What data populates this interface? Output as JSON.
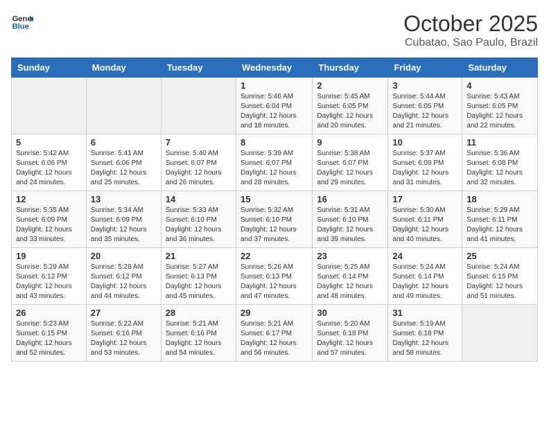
{
  "logo": {
    "line1": "General",
    "line2": "Blue"
  },
  "title": "October 2025",
  "subtitle": "Cubatao, Sao Paulo, Brazil",
  "days_of_week": [
    "Sunday",
    "Monday",
    "Tuesday",
    "Wednesday",
    "Thursday",
    "Friday",
    "Saturday"
  ],
  "weeks": [
    [
      {
        "day": "",
        "info": ""
      },
      {
        "day": "",
        "info": ""
      },
      {
        "day": "",
        "info": ""
      },
      {
        "day": "1",
        "info": "Sunrise: 5:46 AM\nSunset: 6:04 PM\nDaylight: 12 hours\nand 18 minutes."
      },
      {
        "day": "2",
        "info": "Sunrise: 5:45 AM\nSunset: 6:05 PM\nDaylight: 12 hours\nand 20 minutes."
      },
      {
        "day": "3",
        "info": "Sunrise: 5:44 AM\nSunset: 6:05 PM\nDaylight: 12 hours\nand 21 minutes."
      },
      {
        "day": "4",
        "info": "Sunrise: 5:43 AM\nSunset: 6:05 PM\nDaylight: 12 hours\nand 22 minutes."
      }
    ],
    [
      {
        "day": "5",
        "info": "Sunrise: 5:42 AM\nSunset: 6:06 PM\nDaylight: 12 hours\nand 24 minutes."
      },
      {
        "day": "6",
        "info": "Sunrise: 5:41 AM\nSunset: 6:06 PM\nDaylight: 12 hours\nand 25 minutes."
      },
      {
        "day": "7",
        "info": "Sunrise: 5:40 AM\nSunset: 6:07 PM\nDaylight: 12 hours\nand 26 minutes."
      },
      {
        "day": "8",
        "info": "Sunrise: 5:39 AM\nSunset: 6:07 PM\nDaylight: 12 hours\nand 28 minutes."
      },
      {
        "day": "9",
        "info": "Sunrise: 5:38 AM\nSunset: 6:07 PM\nDaylight: 12 hours\nand 29 minutes."
      },
      {
        "day": "10",
        "info": "Sunrise: 5:37 AM\nSunset: 6:08 PM\nDaylight: 12 hours\nand 31 minutes."
      },
      {
        "day": "11",
        "info": "Sunrise: 5:36 AM\nSunset: 6:08 PM\nDaylight: 12 hours\nand 32 minutes."
      }
    ],
    [
      {
        "day": "12",
        "info": "Sunrise: 5:35 AM\nSunset: 6:09 PM\nDaylight: 12 hours\nand 33 minutes."
      },
      {
        "day": "13",
        "info": "Sunrise: 5:34 AM\nSunset: 6:09 PM\nDaylight: 12 hours\nand 35 minutes."
      },
      {
        "day": "14",
        "info": "Sunrise: 5:33 AM\nSunset: 6:10 PM\nDaylight: 12 hours\nand 36 minutes."
      },
      {
        "day": "15",
        "info": "Sunrise: 5:32 AM\nSunset: 6:10 PM\nDaylight: 12 hours\nand 37 minutes."
      },
      {
        "day": "16",
        "info": "Sunrise: 5:31 AM\nSunset: 6:10 PM\nDaylight: 12 hours\nand 39 minutes."
      },
      {
        "day": "17",
        "info": "Sunrise: 5:30 AM\nSunset: 6:11 PM\nDaylight: 12 hours\nand 40 minutes."
      },
      {
        "day": "18",
        "info": "Sunrise: 5:29 AM\nSunset: 6:11 PM\nDaylight: 12 hours\nand 41 minutes."
      }
    ],
    [
      {
        "day": "19",
        "info": "Sunrise: 5:29 AM\nSunset: 6:12 PM\nDaylight: 12 hours\nand 43 minutes."
      },
      {
        "day": "20",
        "info": "Sunrise: 5:28 AM\nSunset: 6:12 PM\nDaylight: 12 hours\nand 44 minutes."
      },
      {
        "day": "21",
        "info": "Sunrise: 5:27 AM\nSunset: 6:13 PM\nDaylight: 12 hours\nand 45 minutes."
      },
      {
        "day": "22",
        "info": "Sunrise: 5:26 AM\nSunset: 6:13 PM\nDaylight: 12 hours\nand 47 minutes."
      },
      {
        "day": "23",
        "info": "Sunrise: 5:25 AM\nSunset: 6:14 PM\nDaylight: 12 hours\nand 48 minutes."
      },
      {
        "day": "24",
        "info": "Sunrise: 5:24 AM\nSunset: 6:14 PM\nDaylight: 12 hours\nand 49 minutes."
      },
      {
        "day": "25",
        "info": "Sunrise: 5:24 AM\nSunset: 6:15 PM\nDaylight: 12 hours\nand 51 minutes."
      }
    ],
    [
      {
        "day": "26",
        "info": "Sunrise: 5:23 AM\nSunset: 6:15 PM\nDaylight: 12 hours\nand 52 minutes."
      },
      {
        "day": "27",
        "info": "Sunrise: 5:22 AM\nSunset: 6:16 PM\nDaylight: 12 hours\nand 53 minutes."
      },
      {
        "day": "28",
        "info": "Sunrise: 5:21 AM\nSunset: 6:16 PM\nDaylight: 12 hours\nand 54 minutes."
      },
      {
        "day": "29",
        "info": "Sunrise: 5:21 AM\nSunset: 6:17 PM\nDaylight: 12 hours\nand 56 minutes."
      },
      {
        "day": "30",
        "info": "Sunrise: 5:20 AM\nSunset: 6:18 PM\nDaylight: 12 hours\nand 57 minutes."
      },
      {
        "day": "31",
        "info": "Sunrise: 5:19 AM\nSunset: 6:18 PM\nDaylight: 12 hours\nand 58 minutes."
      },
      {
        "day": "",
        "info": ""
      }
    ]
  ]
}
